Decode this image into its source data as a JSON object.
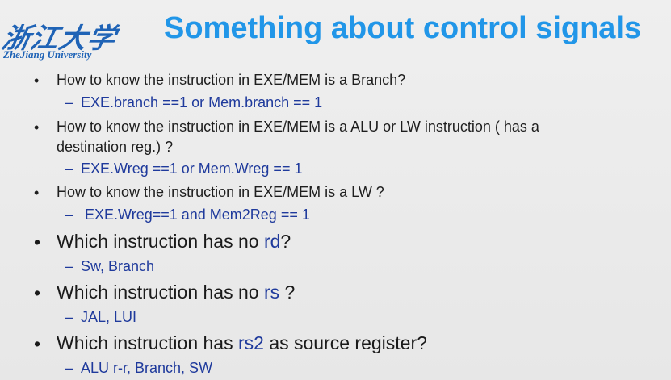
{
  "logo": {
    "chinese": "浙江大学",
    "english": "ZheJiang University"
  },
  "title": "Something about control signals",
  "bullet_char": "•",
  "dash_char": "–",
  "items": [
    {
      "question": "How to know the instruction in EXE/MEM is a Branch?",
      "answer": "EXE.branch ==1  or   Mem.branch  == 1"
    },
    {
      "question_line1": "How to know the instruction in EXE/MEM is a ALU or LW instruction ( has a",
      "question_line2": "destination reg.) ?",
      "answer": "EXE.Wreg ==1  or Mem.Wreg == 1"
    },
    {
      "question": "How to know the instruction in EXE/MEM is a LW ?",
      "answer": " EXE.Wreg==1 and Mem2Reg == 1"
    },
    {
      "question_pre": "Which instruction has no ",
      "question_hl": "rd",
      "question_post": "?",
      "answer": "Sw, Branch"
    },
    {
      "question_pre": "Which instruction has no ",
      "question_hl": "rs",
      "question_post": " ?",
      "answer": "JAL, LUI"
    },
    {
      "question_pre": "Which instruction has ",
      "question_hl": "rs2",
      "question_post": " as source register?",
      "answer": "ALU r-r,  Branch,  SW"
    }
  ]
}
